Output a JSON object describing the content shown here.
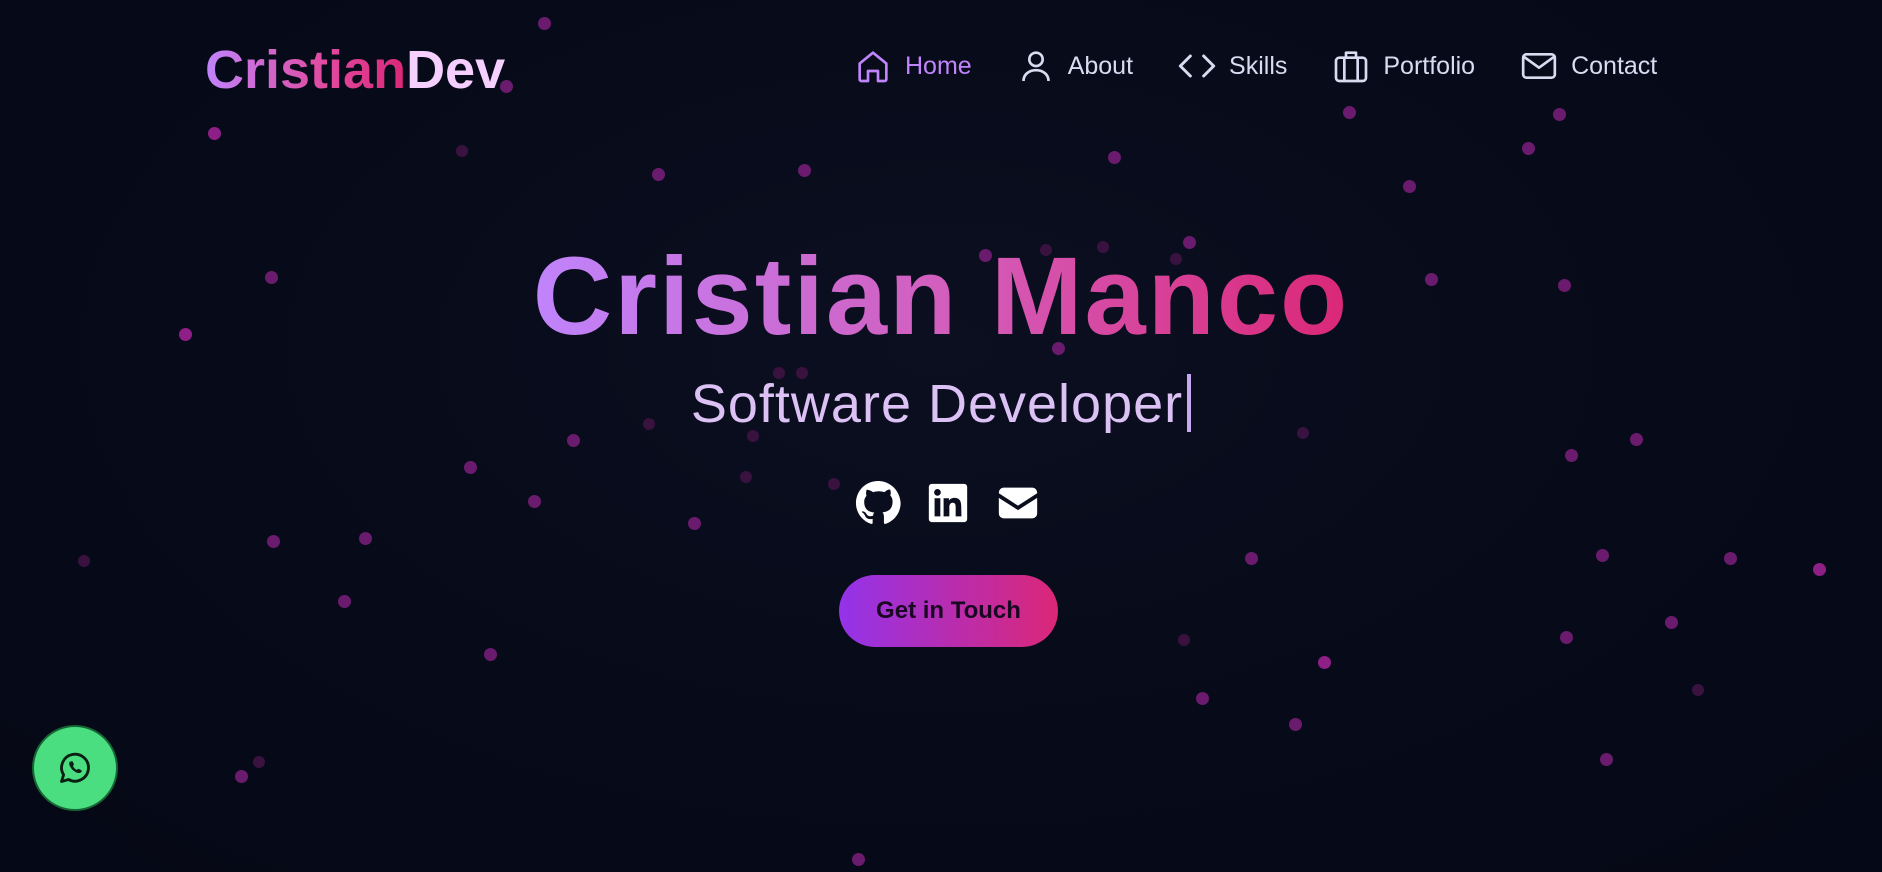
{
  "logo": {
    "part1": "Cristian",
    "part2": "Dev"
  },
  "nav": {
    "home": "Home",
    "about": "About",
    "skills": "Skills",
    "portfolio": "Portfolio",
    "contact": "Contact"
  },
  "hero": {
    "name": "Cristian Manco",
    "subtitle": "Software Developer"
  },
  "socials": [
    "github-icon",
    "linkedin-icon",
    "mail-icon"
  ],
  "cta": {
    "label": "Get in Touch"
  },
  "colors": {
    "background": "#050816",
    "accent_purple": "#c084fc",
    "accent_pink": "#db2777",
    "whatsapp": "#4ade80"
  }
}
